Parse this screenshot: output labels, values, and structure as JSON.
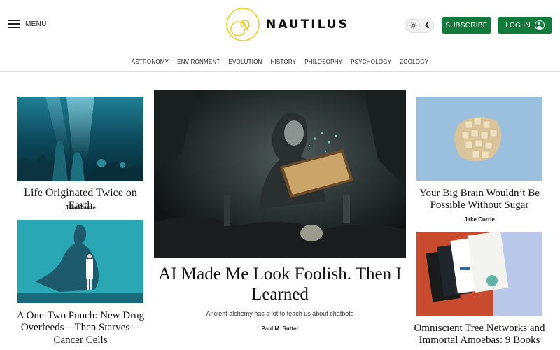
{
  "header": {
    "menu_label": "MENU",
    "logo_text": "NAUTILUS",
    "subscribe_label": "SUBSCRIBE",
    "login_label": "LOG IN",
    "accent_color": "#0f7a3a",
    "logo_color": "#f2cc1a"
  },
  "nav": {
    "items": [
      "ASTRONOMY",
      "ENVIRONMENT",
      "EVOLUTION",
      "HISTORY",
      "PHILOSOPHY",
      "PSYCHOLOGY",
      "ZOOLOGY"
    ]
  },
  "articles": {
    "left_top": {
      "title": "Life Originated Twice on Earth",
      "author": "Jake Currie"
    },
    "left_bottom": {
      "title": "A One-Two Punch: New Drug Overfeeds—Then Starves—Cancer Cells"
    },
    "feature": {
      "title": "AI Made Me Look Foolish. Then I Learned",
      "dek": "Ancient alchemy has a lot to teach us about chatbots",
      "author": "Paul M. Sutter"
    },
    "right_top": {
      "title": "Your Big Brain Wouldn’t Be Possible Without Sugar",
      "author": "Jake Currie"
    },
    "right_bottom": {
      "title": "Omniscient Tree Networks and Immortal Amoebas: 9 Books"
    }
  }
}
